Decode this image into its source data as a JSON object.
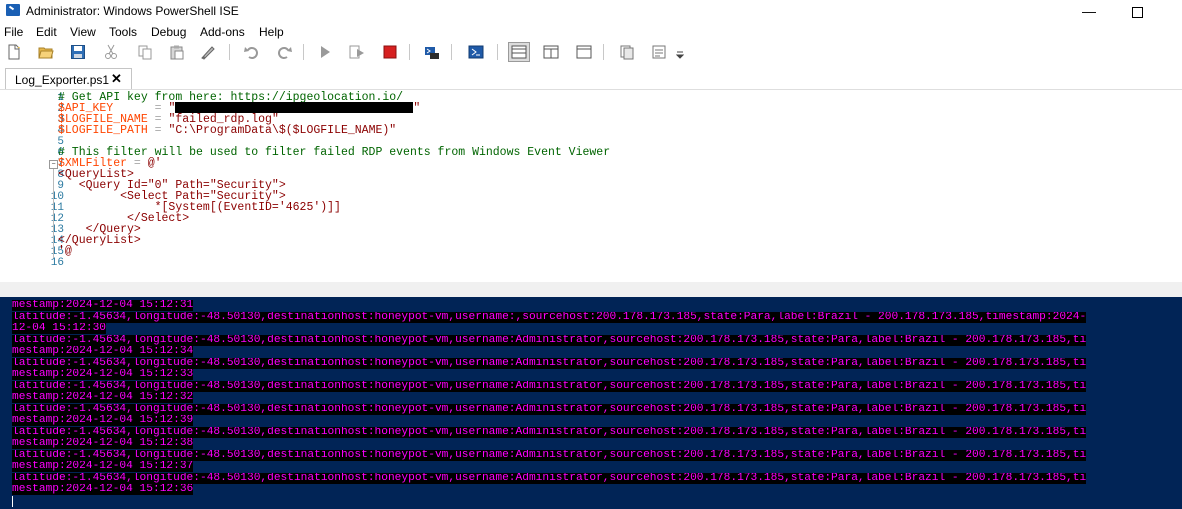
{
  "window": {
    "title": "Administrator: Windows PowerShell ISE",
    "minimize_glyph": "—"
  },
  "menu": [
    "File",
    "Edit",
    "View",
    "Tools",
    "Debug",
    "Add-ons",
    "Help"
  ],
  "toolbar": {
    "icons": [
      "new-file-icon",
      "open-file-icon",
      "save-icon",
      "cut-icon",
      "copy-icon",
      "paste-icon",
      "clear-icon",
      "undo-icon",
      "redo-icon",
      "run-script-icon",
      "run-selection-icon",
      "stop-icon",
      "remote-powershell-icon",
      "powershell-console-icon",
      "layout-top-icon",
      "layout-right-icon",
      "layout-max-icon",
      "show-script-pane-icon",
      "command-addon-icon",
      "toolbar-overflow-icon"
    ]
  },
  "tab": {
    "label": "Log_Exporter.ps1",
    "close_glyph": "✕"
  },
  "editor": {
    "line_numbers": [
      "1",
      "2",
      "3",
      "4",
      "5",
      "6",
      "7",
      "8",
      "9",
      "10",
      "11",
      "12",
      "13",
      "14",
      "15",
      "16"
    ],
    "lines": {
      "l1": "# Get API key from here: https://ipgeolocation.io/",
      "l2_var": "$API_KEY",
      "l2_op": "      = ",
      "l2_q1": "\"",
      "l2_q2": "\"",
      "l3_var": "$LOGFILE_NAME",
      "l3_op": " = ",
      "l3_str": "\"failed_rdp.log\"",
      "l4_var": "$LOGFILE_PATH",
      "l4_op": " = ",
      "l4_str": "\"C:\\ProgramData\\$($LOGFILE_NAME)\"",
      "l6": "# This filter will be used to filter failed RDP events from Windows Event Viewer",
      "l7_var": "$XMLFilter",
      "l7_op": " = ",
      "l7_str": "@'",
      "l8": "<QueryList>",
      "l9": "   <Query Id=\"0\" Path=\"Security\">",
      "l10": "         <Select Path=\"Security\">",
      "l11": "              *[System[(EventID='4625')]]",
      "l12": "          </Select>",
      "l13": "    </Query>",
      "l14": "</QueryList>",
      "l15": "'@"
    }
  },
  "console": {
    "lines": [
      "mestamp:2024-12-04 15:12:31",
      "latitude:-1.45634,longitude:-48.50130,destinationhost:honeypot-vm,username:,sourcehost:200.178.173.185,state:Para,label:Brazil - 200.178.173.185,timestamp:2024-",
      "12-04 15:12:30",
      "latitude:-1.45634,longitude:-48.50130,destinationhost:honeypot-vm,username:Administrator,sourcehost:200.178.173.185,state:Para,label:Brazil - 200.178.173.185,ti",
      "mestamp:2024-12-04 15:12:34",
      "latitude:-1.45634,longitude:-48.50130,destinationhost:honeypot-vm,username:Administrator,sourcehost:200.178.173.185,state:Para,label:Brazil - 200.178.173.185,ti",
      "mestamp:2024-12-04 15:12:33",
      "latitude:-1.45634,longitude:-48.50130,destinationhost:honeypot-vm,username:Administrator,sourcehost:200.178.173.185,state:Para,label:Brazil - 200.178.173.185,ti",
      "mestamp:2024-12-04 15:12:32",
      "latitude:-1.45634,longitude:-48.50130,destinationhost:honeypot-vm,username:Administrator,sourcehost:200.178.173.185,state:Para,label:Brazil - 200.178.173.185,ti",
      "mestamp:2024-12-04 15:12:39",
      "latitude:-1.45634,longitude:-48.50130,destinationhost:honeypot-vm,username:Administrator,sourcehost:200.178.173.185,state:Para,label:Brazil - 200.178.173.185,ti",
      "mestamp:2024-12-04 15:12:38",
      "latitude:-1.45634,longitude:-48.50130,destinationhost:honeypot-vm,username:Administrator,sourcehost:200.178.173.185,state:Para,label:Brazil - 200.178.173.185,ti",
      "mestamp:2024-12-04 15:12:37",
      "latitude:-1.45634,longitude:-48.50130,destinationhost:honeypot-vm,username:Administrator,sourcehost:200.178.173.185,state:Para,label:Brazil - 200.178.173.185,ti",
      "mestamp:2024-12-04 15:12:36"
    ]
  },
  "colors": {
    "console_bg": "#012456",
    "console_text": "#ff00ff",
    "comment": "#006400",
    "variable": "#ff4500",
    "string": "#8b0000"
  }
}
